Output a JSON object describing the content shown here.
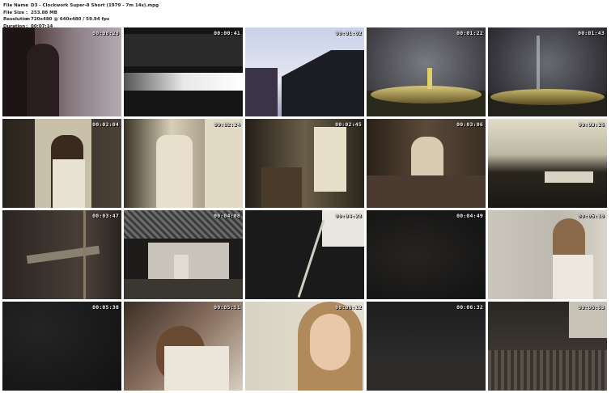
{
  "header": {
    "file_name_label": "File Name",
    "file_name": "D3 - Clockwork Super-8 Short (1979 - 7m 14s).mpg",
    "file_size_label": "File Size",
    "file_size": "253.88 MB",
    "resolution_label": "Resolution",
    "resolution": "720x480 @ 640x480 / 59.94 fps",
    "duration_label": "Duration",
    "duration": "00:07:14",
    "separator": ":"
  },
  "thumbnails": [
    {
      "timestamp": "00:00:20"
    },
    {
      "timestamp": "00:00:41"
    },
    {
      "timestamp": "00:01:02"
    },
    {
      "timestamp": "00:01:22"
    },
    {
      "timestamp": "00:01:43"
    },
    {
      "timestamp": "00:02:04"
    },
    {
      "timestamp": "00:02:24"
    },
    {
      "timestamp": "00:02:45"
    },
    {
      "timestamp": "00:03:06"
    },
    {
      "timestamp": "00:03:26"
    },
    {
      "timestamp": "00:03:47"
    },
    {
      "timestamp": "00:04:08"
    },
    {
      "timestamp": "00:04:28"
    },
    {
      "timestamp": "00:04:49"
    },
    {
      "timestamp": "00:05:10"
    },
    {
      "timestamp": "00:05:30"
    },
    {
      "timestamp": "00:05:51"
    },
    {
      "timestamp": "00:06:12"
    },
    {
      "timestamp": "00:06:32"
    },
    {
      "timestamp": "00:06:53"
    }
  ]
}
